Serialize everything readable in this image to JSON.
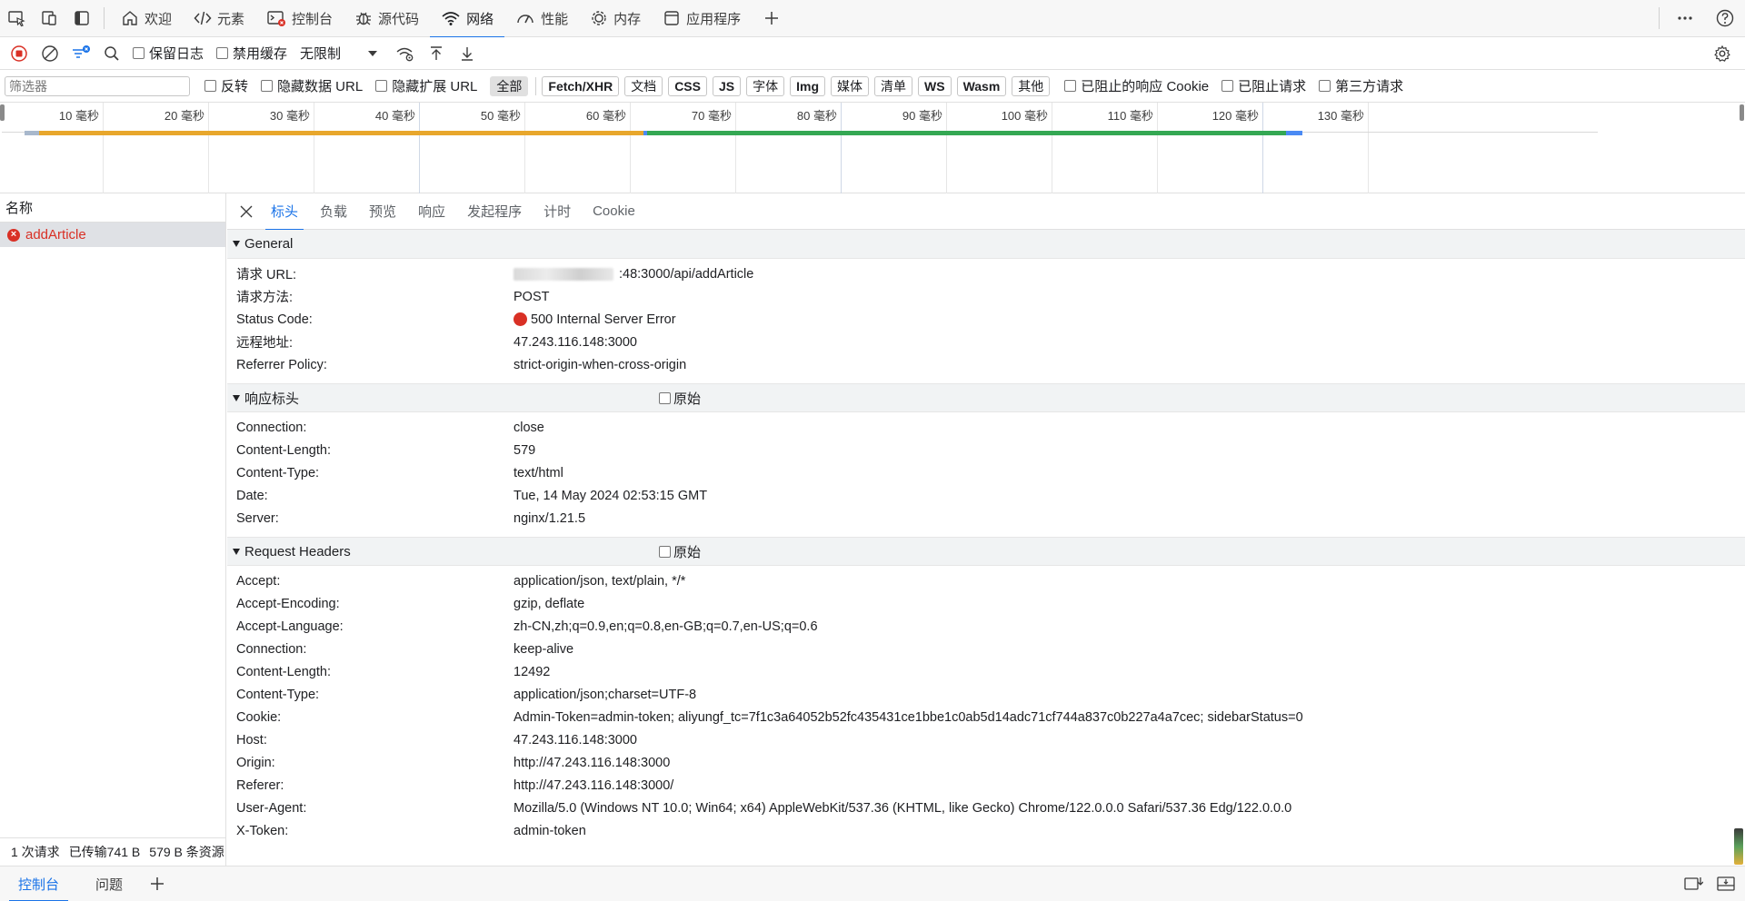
{
  "top_tabs": [
    {
      "label": "欢迎",
      "icon": "home-icon"
    },
    {
      "label": "元素",
      "icon": "code-icon"
    },
    {
      "label": "控制台",
      "icon": "console-icon"
    },
    {
      "label": "源代码",
      "icon": "bug-icon"
    },
    {
      "label": "网络",
      "icon": "wifi-icon"
    },
    {
      "label": "性能",
      "icon": "performance-icon"
    },
    {
      "label": "内存",
      "icon": "memory-icon"
    },
    {
      "label": "应用程序",
      "icon": "application-icon"
    }
  ],
  "toolbar": {
    "preserve_log": "保留日志",
    "disable_cache": "禁用缓存",
    "throttling": "无限制"
  },
  "filter": {
    "placeholder": "筛选器",
    "invert": "反转",
    "hide_data_urls": "隐藏数据 URL",
    "hide_extension_urls": "隐藏扩展 URL",
    "types": [
      "全部",
      "Fetch/XHR",
      "文档",
      "CSS",
      "JS",
      "字体",
      "Img",
      "媒体",
      "清单",
      "WS",
      "Wasm",
      "其他"
    ],
    "blocked_cookies": "已阻止的响应 Cookie",
    "blocked_requests": "已阻止请求",
    "third_party": "第三方请求"
  },
  "timeline": {
    "ticks": [
      "10 毫秒",
      "20 毫秒",
      "30 毫秒",
      "40 毫秒",
      "50 毫秒",
      "60 毫秒",
      "70 毫秒",
      "80 毫秒",
      "90 毫秒",
      "100 毫秒",
      "110 毫秒",
      "120 毫秒",
      "130 毫秒"
    ],
    "phases": [
      {
        "start_ms": 2.6,
        "end_ms": 4.0,
        "color": "#a8b8cc"
      },
      {
        "start_ms": 4.0,
        "end_ms": 61.3,
        "color": "#e8a72c"
      },
      {
        "start_ms": 61.3,
        "end_ms": 61.6,
        "color": "#4a8af4"
      },
      {
        "start_ms": 61.6,
        "end_ms": 122.2,
        "color": "#34a853"
      },
      {
        "start_ms": 122.2,
        "end_ms": 123.8,
        "color": "#4a8af4"
      }
    ]
  },
  "request_list": {
    "header": "名称",
    "items": [
      {
        "name": "addArticle",
        "status": "error"
      }
    ],
    "summary": [
      "1 次请求",
      "已传输741 B",
      "579 B 条资源"
    ]
  },
  "details": {
    "tabs": [
      "标头",
      "负载",
      "预览",
      "响应",
      "发起程序",
      "计时",
      "Cookie"
    ],
    "raw_label": "原始",
    "general": {
      "title": "General",
      "rows": [
        {
          "k": "请求 URL:",
          "v": ":48:3000/api/addArticle"
        },
        {
          "k": "请求方法:",
          "v": "POST"
        },
        {
          "k": "Status Code:",
          "v": "500 Internal Server Error"
        },
        {
          "k": "远程地址:",
          "v": "47.243.116.148:3000"
        },
        {
          "k": "Referrer Policy:",
          "v": "strict-origin-when-cross-origin"
        }
      ]
    },
    "response_headers": {
      "title": "响应标头",
      "rows": [
        {
          "k": "Connection:",
          "v": "close"
        },
        {
          "k": "Content-Length:",
          "v": "579"
        },
        {
          "k": "Content-Type:",
          "v": "text/html"
        },
        {
          "k": "Date:",
          "v": "Tue, 14 May 2024 02:53:15 GMT"
        },
        {
          "k": "Server:",
          "v": "nginx/1.21.5"
        }
      ]
    },
    "request_headers": {
      "title": "Request Headers",
      "rows": [
        {
          "k": "Accept:",
          "v": "application/json, text/plain, */*"
        },
        {
          "k": "Accept-Encoding:",
          "v": "gzip, deflate"
        },
        {
          "k": "Accept-Language:",
          "v": "zh-CN,zh;q=0.9,en;q=0.8,en-GB;q=0.7,en-US;q=0.6"
        },
        {
          "k": "Connection:",
          "v": "keep-alive"
        },
        {
          "k": "Content-Length:",
          "v": "12492"
        },
        {
          "k": "Content-Type:",
          "v": "application/json;charset=UTF-8"
        },
        {
          "k": "Cookie:",
          "v": "Admin-Token=admin-token; aliyungf_tc=7f1c3a64052b52fc435431ce1bbe1c0ab5d14adc71cf744a837c0b227a4a7cec; sidebarStatus=0"
        },
        {
          "k": "Host:",
          "v": "47.243.116.148:3000"
        },
        {
          "k": "Origin:",
          "v": "http://47.243.116.148:3000"
        },
        {
          "k": "Referer:",
          "v": "http://47.243.116.148:3000/"
        },
        {
          "k": "User-Agent:",
          "v": "Mozilla/5.0 (Windows NT 10.0; Win64; x64) AppleWebKit/537.36 (KHTML, like Gecko) Chrome/122.0.0.0 Safari/537.36 Edg/122.0.0.0"
        },
        {
          "k": "X-Token:",
          "v": "admin-token"
        }
      ]
    }
  },
  "drawer": {
    "tabs": [
      "控制台",
      "问题"
    ]
  },
  "colors": {
    "accent": "#1a73e8",
    "error": "#d93025"
  }
}
